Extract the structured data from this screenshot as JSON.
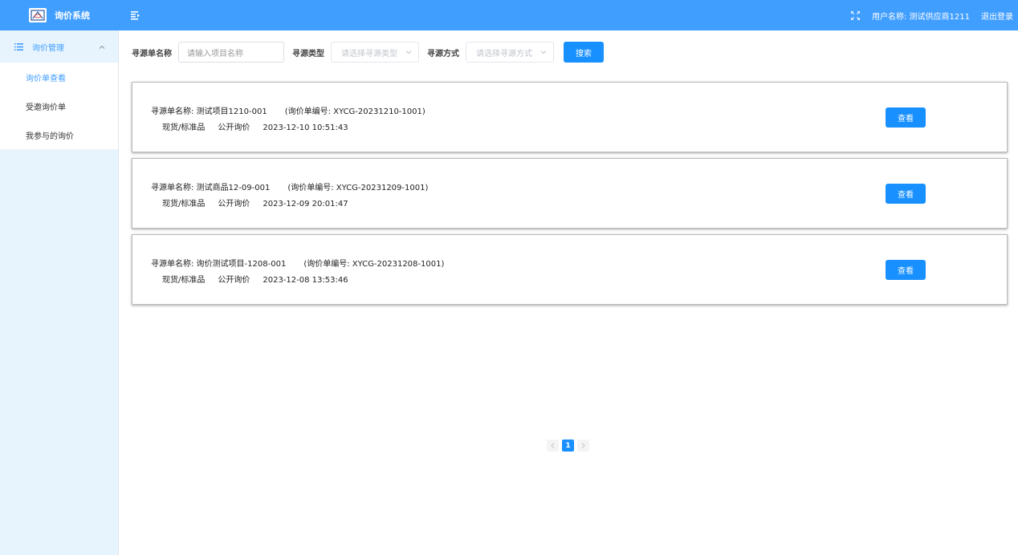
{
  "app": {
    "title": "询价系统"
  },
  "header": {
    "user_label": "用户名称: 测试供应商1211",
    "logout_label": "退出登录"
  },
  "sidebar": {
    "group_label": "询价管理",
    "items": [
      {
        "label": "询价单查看",
        "active": true
      },
      {
        "label": "受邀询价单",
        "active": false
      },
      {
        "label": "我参与的询价",
        "active": false
      }
    ]
  },
  "filters": {
    "name_label": "寻源单名称",
    "name_placeholder": "请输入项目名称",
    "type_label": "寻源类型",
    "type_placeholder": "请选择寻源类型",
    "method_label": "寻源方式",
    "method_placeholder": "请选择寻源方式",
    "search_label": "搜索"
  },
  "records": [
    {
      "name_text": "寻源单名称: 测试项目1210-001",
      "code_text": "(询价单编号: XYCG-20231210-1001)",
      "category": "现货/标准品",
      "method": "公开询价",
      "time": "2023-12-10 10:51:43",
      "action_label": "查看"
    },
    {
      "name_text": "寻源单名称: 测试商品12-09-001",
      "code_text": "(询价单编号: XYCG-20231209-1001)",
      "category": "现货/标准品",
      "method": "公开询价",
      "time": "2023-12-09 20:01:47",
      "action_label": "查看"
    },
    {
      "name_text": "寻源单名称: 询价测试项目-1208-001",
      "code_text": "(询价单编号: XYCG-20231208-1001)",
      "category": "现货/标准品",
      "method": "公开询价",
      "time": "2023-12-08 13:53:46",
      "action_label": "查看"
    }
  ],
  "pagination": {
    "current_page": "1"
  },
  "colors": {
    "primary": "#409eff",
    "button": "#1890ff",
    "sidebar_bg": "#e8f4fd"
  }
}
